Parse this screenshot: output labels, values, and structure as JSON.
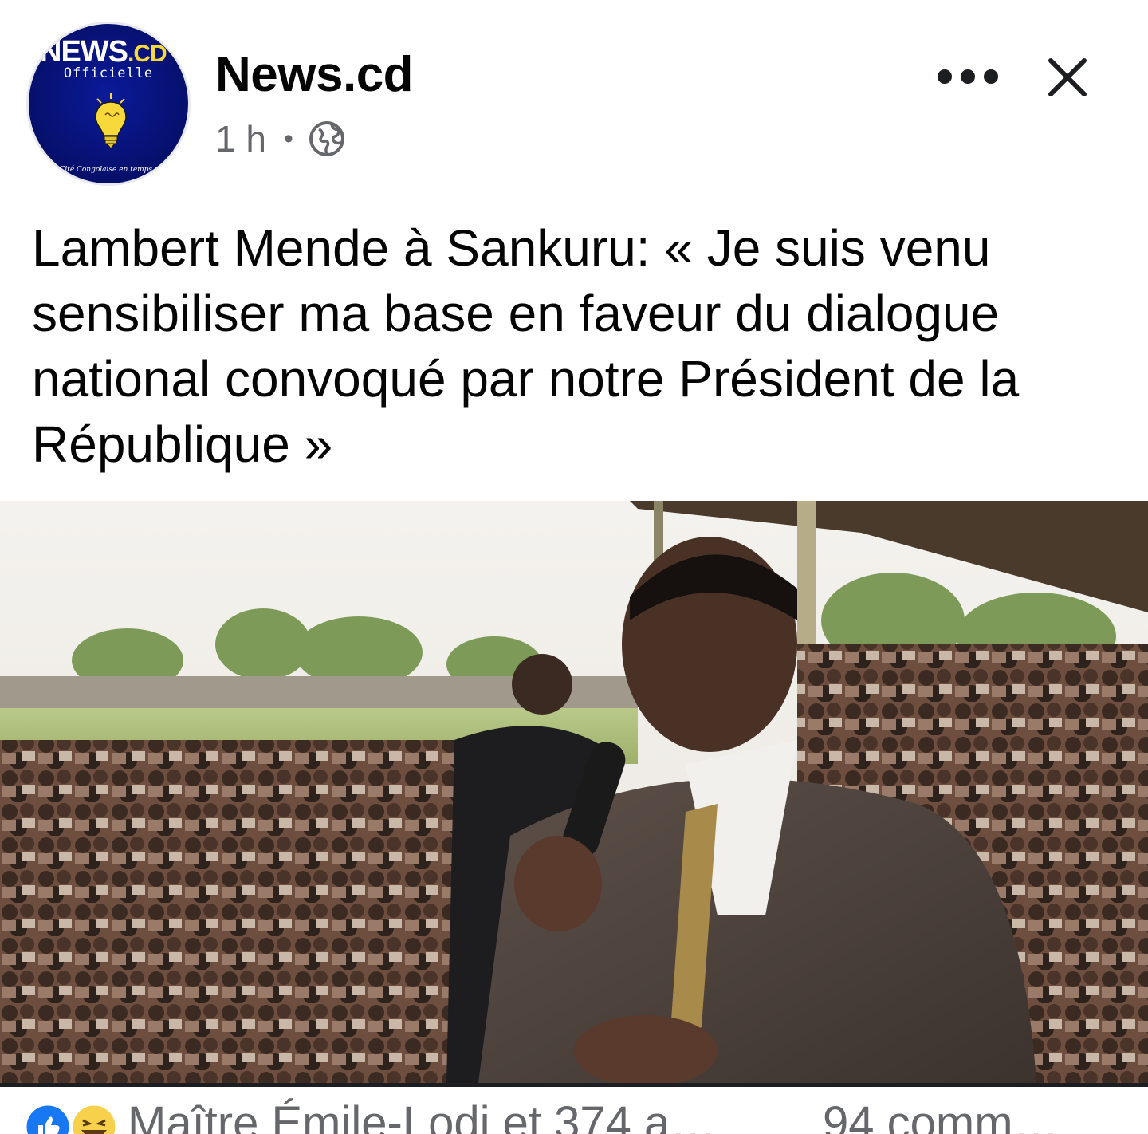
{
  "page": {
    "name": "News.cd",
    "time": "1 h",
    "separator": "•",
    "audience_icon": "globe-icon"
  },
  "avatar": {
    "brand_main": "NEWS",
    "brand_suffix": ".CD",
    "subtitle": "Officielle",
    "tagline": "La Cité Congolaise en temps réel",
    "icon": "lightbulb-icon"
  },
  "header_actions": {
    "more_icon": "more-horizontal-icon",
    "close_icon": "close-icon"
  },
  "post": {
    "text": "Lambert Mende à Sankuru: « Je suis venu sensibiliser ma base en faveur du dialogue national convoqué par notre Président de la République »"
  },
  "reactions": {
    "icons": [
      "like-icon",
      "haha-icon"
    ],
    "summary": "Maître Émile-Lodi et 374 a…",
    "comments": "94 comm…"
  },
  "colors": {
    "text": "#050505",
    "secondary": "#65676b",
    "like_blue": "#1877f2",
    "avatar_blue": "#06106b",
    "bulb_yellow": "#f7d93b"
  }
}
